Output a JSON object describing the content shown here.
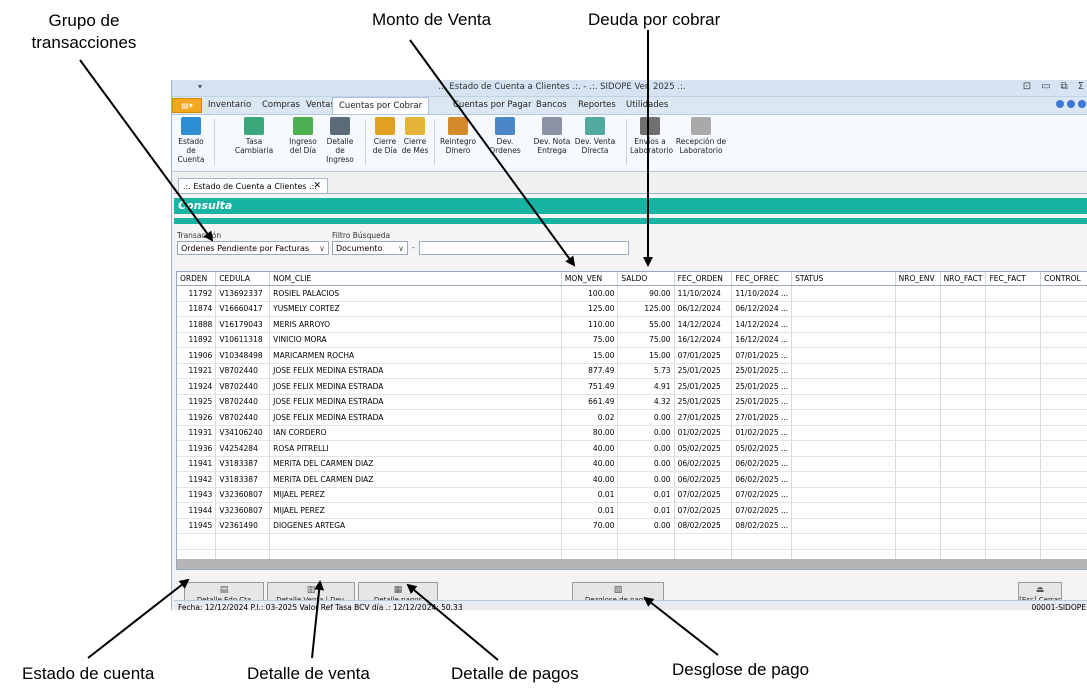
{
  "annotations": {
    "grupo_transacciones": "Grupo de\ntransacciones",
    "monto_venta": "Monto de Venta",
    "deuda_cobrar": "Deuda por cobrar",
    "estado_cuenta": "Estado de cuenta",
    "detalle_venta": "Detalle de venta",
    "detalle_pagos": "Detalle de pagos",
    "desglose_pago": "Desglose de pago"
  },
  "window": {
    "title": ".:. Estado de Cuenta a Clientes .:. - .:. SIDOPE Ver. 2025 .:.",
    "quick_access": "▾"
  },
  "menu": {
    "file": "▤▾",
    "tabs": [
      "Inventario",
      "Compras",
      "Ventas",
      "Cuentas por Cobrar",
      "Cuentas por Pagar",
      "Bancos",
      "Reportes",
      "Utilidades"
    ],
    "active_tab": "Cuentas por Cobrar"
  },
  "ribbon": {
    "buttons": [
      {
        "label": "Estado de\nCuenta",
        "icon": "bank-icon"
      },
      {
        "label": "Tasa Cambiaria",
        "icon": "exchange-icon"
      },
      {
        "label": "Ingreso\ndel Día",
        "icon": "money-icon"
      },
      {
        "label": "Detalle de\nIngreso",
        "icon": "calculator-icon"
      },
      {
        "label": "Cierre\nde Día",
        "icon": "calendar-day-icon"
      },
      {
        "label": "Cierre\nde Mes",
        "icon": "calendar-month-icon"
      },
      {
        "label": "Reintegro\nDinero",
        "icon": "refund-icon"
      },
      {
        "label": "Dev. Ordenes",
        "icon": "return-orders-icon"
      },
      {
        "label": "Dev. Nota\nEntrega",
        "icon": "return-note-icon"
      },
      {
        "label": "Dev. Venta\nDirecta",
        "icon": "return-sale-icon"
      },
      {
        "label": "Envíos a\nLaboratorio",
        "icon": "send-lab-icon"
      },
      {
        "label": "Recepción de\nLaboratorio",
        "icon": "receive-lab-icon"
      }
    ]
  },
  "document_tab": ".:. Estado de Cuenta a Clientes .:.",
  "header_title": "Consulta",
  "filters": {
    "transaccion_label": "Transacción",
    "transaccion_value": "Ordenes Pendiente por Facturas",
    "filtro_label": "Filtro Búsqueda",
    "filtro_value": "Documento",
    "dash": "-",
    "search_value": ""
  },
  "table": {
    "columns": [
      "ORDEN",
      "CEDULA",
      "NOM_CLIE",
      "MON_VEN",
      "SALDO",
      "FEC_ORDEN",
      "FEC_OFREC",
      "STATUS",
      "NRO_ENV",
      "NRO_FACT",
      "FEC_FACT",
      "CONTROL"
    ],
    "rows": [
      [
        "11792",
        "V13692337",
        "ROSIEL PALACIOS",
        "100.00",
        "90.00",
        "11/10/2024",
        "11/10/2024 ...",
        "",
        "",
        "",
        "",
        ""
      ],
      [
        "11874",
        "V16660417",
        "YUSMELY CORTEZ",
        "125.00",
        "125.00",
        "06/12/2024",
        "06/12/2024 ...",
        "",
        "",
        "",
        "",
        ""
      ],
      [
        "11888",
        "V16179043",
        "MERIS ARROYO",
        "110.00",
        "55.00",
        "14/12/2024",
        "14/12/2024 ...",
        "",
        "",
        "",
        "",
        ""
      ],
      [
        "11892",
        "V10611318",
        "VINICIO MORA",
        "75.00",
        "75.00",
        "16/12/2024",
        "16/12/2024 ...",
        "",
        "",
        "",
        "",
        ""
      ],
      [
        "11906",
        "V10348498",
        "MARICARMEN ROCHA",
        "15.00",
        "15.00",
        "07/01/2025",
        "07/01/2025 ...",
        "",
        "",
        "",
        "",
        ""
      ],
      [
        "11921",
        "V8702440",
        "JOSE FELIX MEDINA ESTRADA",
        "877.49",
        "5.73",
        "25/01/2025",
        "25/01/2025 ...",
        "",
        "",
        "",
        "",
        ""
      ],
      [
        "11924",
        "V8702440",
        "JOSE FELIX MEDINA ESTRADA",
        "751.49",
        "4.91",
        "25/01/2025",
        "25/01/2025 ...",
        "",
        "",
        "",
        "",
        ""
      ],
      [
        "11925",
        "V8702440",
        "JOSE FELIX MEDINA ESTRADA",
        "661.49",
        "4.32",
        "25/01/2025",
        "25/01/2025 ...",
        "",
        "",
        "",
        "",
        ""
      ],
      [
        "11926",
        "V8702440",
        "JOSE FELIX MEDINA ESTRADA",
        "0.02",
        "0.00",
        "27/01/2025",
        "27/01/2025 ...",
        "",
        "",
        "",
        "",
        ""
      ],
      [
        "11931",
        "V34106240",
        "IAN CORDERO",
        "80.00",
        "0.00",
        "01/02/2025",
        "01/02/2025 ...",
        "",
        "",
        "",
        "",
        ""
      ],
      [
        "11936",
        "V4254284",
        "ROSA PITRELLI",
        "40.00",
        "0.00",
        "05/02/2025",
        "05/02/2025 ...",
        "",
        "",
        "",
        "",
        ""
      ],
      [
        "11941",
        "V3183387",
        "MERITA DEL CARMEN DIAZ",
        "40.00",
        "0.00",
        "06/02/2025",
        "06/02/2025 ...",
        "",
        "",
        "",
        "",
        ""
      ],
      [
        "11942",
        "V3183387",
        "MERITA DEL CARMEN DIAZ",
        "40.00",
        "0.00",
        "06/02/2025",
        "06/02/2025 ...",
        "",
        "",
        "",
        "",
        ""
      ],
      [
        "11943",
        "V32360807",
        "MIJAEL PEREZ",
        "0.01",
        "0.01",
        "07/02/2025",
        "07/02/2025 ...",
        "",
        "",
        "",
        "",
        ""
      ],
      [
        "11944",
        "V32360807",
        "MIJAEL PEREZ",
        "0.01",
        "0.01",
        "07/02/2025",
        "07/02/2025 ...",
        "",
        "",
        "",
        "",
        ""
      ],
      [
        "11945",
        "V2361490",
        "DIOGENES ARTEGA",
        "70.00",
        "0.00",
        "08/02/2025",
        "08/02/2025 ...",
        "",
        "",
        "",
        "",
        ""
      ]
    ]
  },
  "bottom_buttons": {
    "detalle_edo": "Detalle Edo.Cta",
    "detalle_venta": "Detalle Venta | Dev.",
    "detalle_pagos": "Detalle pagos",
    "desglose": "Dezglose de pagos",
    "cerrar": "[Esc] Cerrar"
  },
  "status_bar": {
    "left": "Fecha:  12/12/2024   P.I.: 03-2025   Valor Ref Tasa BCV día .:  12/12/2024:  50.33",
    "right": "00001-SIDOPE"
  },
  "colors": {
    "accent_teal": "#17b3a3",
    "ribbon_blue": "#dce7f4",
    "file_orange": "#f3a61f"
  }
}
